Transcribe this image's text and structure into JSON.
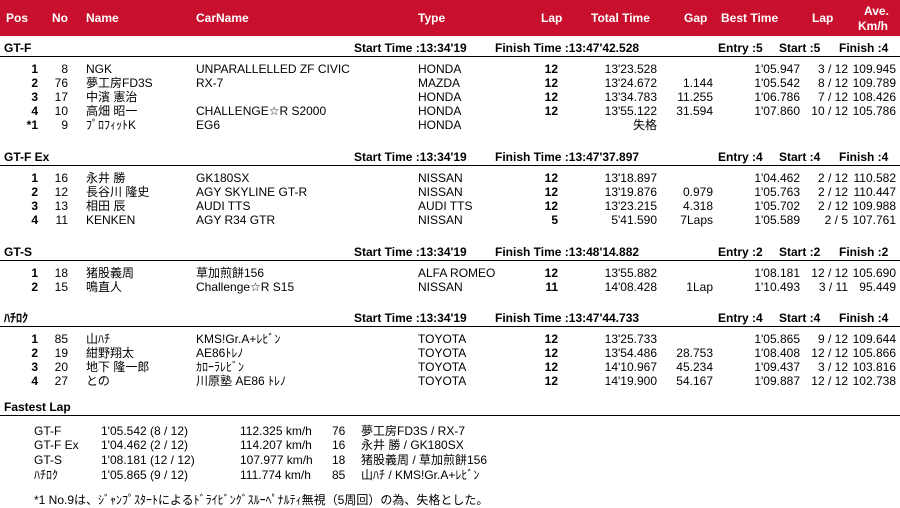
{
  "header": {
    "pos": "Pos",
    "no": "No",
    "name": "Name",
    "carname": "CarName",
    "type": "Type",
    "lap": "Lap",
    "total_time": "Total Time",
    "gap": "Gap",
    "best_time": "Best Time",
    "best_lap": "Lap",
    "ave_line1": "Ave.",
    "ave_line2": "Km/h"
  },
  "classes": [
    {
      "name": "GT-F",
      "start": "Start Time :13:34'19",
      "finish": "Finish Time :13:47'42.528",
      "entry": "Entry :5",
      "started": "Start :5",
      "finished": "Finish :4",
      "rows": [
        {
          "pos": "1",
          "no": "8",
          "name": "NGK",
          "car": "UNPARALLELLED ZF CIVIC",
          "type": "HONDA",
          "lap": "12",
          "total": "13'23.528",
          "gap": "",
          "best": "1'05.947",
          "blap": "3 / 12",
          "ave": "109.945"
        },
        {
          "pos": "2",
          "no": "76",
          "name": "夢工房FD3S",
          "car": "RX-7",
          "type": "MAZDA",
          "lap": "12",
          "total": "13'24.672",
          "gap": "1.144",
          "best": "1'05.542",
          "blap": "8 / 12",
          "ave": "109.789"
        },
        {
          "pos": "3",
          "no": "17",
          "name": "中濱 憲治",
          "car": "",
          "type": "HONDA",
          "lap": "12",
          "total": "13'34.783",
          "gap": "11.255",
          "best": "1'06.786",
          "blap": "7 / 12",
          "ave": "108.426"
        },
        {
          "pos": "4",
          "no": "10",
          "name": "高畑 昭一",
          "car": "CHALLENGE☆R S2000",
          "type": "HONDA",
          "lap": "12",
          "total": "13'55.122",
          "gap": "31.594",
          "best": "1'07.860",
          "blap": "10 / 12",
          "ave": "105.786"
        },
        {
          "pos": "*1",
          "no": "9",
          "name": "ﾌﾟﾛﾌｨｯﾄK",
          "car": "EG6",
          "type": "HONDA",
          "lap": "",
          "total": "失格",
          "gap": "",
          "best": "",
          "blap": "",
          "ave": ""
        }
      ]
    },
    {
      "name": "GT-F Ex",
      "start": "Start Time :13:34'19",
      "finish": "Finish Time :13:47'37.897",
      "entry": "Entry :4",
      "started": "Start :4",
      "finished": "Finish :4",
      "rows": [
        {
          "pos": "1",
          "no": "16",
          "name": "永井 勝",
          "car": "GK180SX",
          "type": "NISSAN",
          "lap": "12",
          "total": "13'18.897",
          "gap": "",
          "best": "1'04.462",
          "blap": "2 / 12",
          "ave": "110.582"
        },
        {
          "pos": "2",
          "no": "12",
          "name": "長谷川 隆史",
          "car": "AGY SKYLINE GT-R",
          "type": "NISSAN",
          "lap": "12",
          "total": "13'19.876",
          "gap": "0.979",
          "best": "1'05.763",
          "blap": "2 / 12",
          "ave": "110.447"
        },
        {
          "pos": "3",
          "no": "13",
          "name": "相田 辰",
          "car": "AUDI TTS",
          "type": "AUDI TTS",
          "lap": "12",
          "total": "13'23.215",
          "gap": "4.318",
          "best": "1'05.702",
          "blap": "2 / 12",
          "ave": "109.988"
        },
        {
          "pos": "4",
          "no": "11",
          "name": "KENKEN",
          "car": "AGY R34 GTR",
          "type": "NISSAN",
          "lap": "5",
          "total": "5'41.590",
          "gap": "7Laps",
          "best": "1'05.589",
          "blap": "2 / 5",
          "ave": "107.761"
        }
      ]
    },
    {
      "name": "GT-S",
      "start": "Start Time :13:34'19",
      "finish": "Finish Time :13:48'14.882",
      "entry": "Entry :2",
      "started": "Start :2",
      "finished": "Finish :2",
      "rows": [
        {
          "pos": "1",
          "no": "18",
          "name": "猪股義周",
          "car": "草加煎餅156",
          "type": "ALFA ROMEO",
          "lap": "12",
          "total": "13'55.882",
          "gap": "",
          "best": "1'08.181",
          "blap": "12 / 12",
          "ave": "105.690"
        },
        {
          "pos": "2",
          "no": "15",
          "name": "鳴直人",
          "car": "Challenge☆R S15",
          "type": "NISSAN",
          "lap": "11",
          "total": "14'08.428",
          "gap": "1Lap",
          "best": "1'10.493",
          "blap": "3 / 11",
          "ave": "95.449"
        }
      ]
    },
    {
      "name": "ﾊﾁﾛｸ",
      "start": "Start Time :13:34'19",
      "finish": "Finish Time :13:47'44.733",
      "entry": "Entry :4",
      "started": "Start :4",
      "finished": "Finish :4",
      "rows": [
        {
          "pos": "1",
          "no": "85",
          "name": "山ﾊﾁ",
          "car": "KMS!Gr.A+ﾚﾋﾞﾝ",
          "type": "TOYOTA",
          "lap": "12",
          "total": "13'25.733",
          "gap": "",
          "best": "1'05.865",
          "blap": "9 / 12",
          "ave": "109.644"
        },
        {
          "pos": "2",
          "no": "19",
          "name": "紺野翔太",
          "car": "AE86ﾄﾚﾉ",
          "type": "TOYOTA",
          "lap": "12",
          "total": "13'54.486",
          "gap": "28.753",
          "best": "1'08.408",
          "blap": "12 / 12",
          "ave": "105.866"
        },
        {
          "pos": "3",
          "no": "20",
          "name": "地下 隆一郎",
          "car": "ｶﾛｰﾗﾚﾋﾞﾝ",
          "type": "TOYOTA",
          "lap": "12",
          "total": "14'10.967",
          "gap": "45.234",
          "best": "1'09.437",
          "blap": "3 / 12",
          "ave": "103.816"
        },
        {
          "pos": "4",
          "no": "27",
          "name": "との",
          "car": "川原塾 AE86 ﾄﾚﾉ",
          "type": "TOYOTA",
          "lap": "12",
          "total": "14'19.900",
          "gap": "54.167",
          "best": "1'09.887",
          "blap": "12 / 12",
          "ave": "102.738"
        }
      ]
    }
  ],
  "fastest_lap": {
    "title": "Fastest Lap",
    "rows": [
      {
        "cls": "GT-F",
        "time": "1'05.542 (8 / 12)",
        "speed": "112.325 km/h",
        "no": "76",
        "who": "夢工房FD3S / RX-7"
      },
      {
        "cls": "GT-F Ex",
        "time": "1'04.462 (2 / 12)",
        "speed": "114.207 km/h",
        "no": "16",
        "who": "永井 勝 / GK180SX"
      },
      {
        "cls": "GT-S",
        "time": "1'08.181 (12 / 12)",
        "speed": "107.977 km/h",
        "no": "18",
        "who": "猪股義周 / 草加煎餅156"
      },
      {
        "cls": "ﾊﾁﾛｸ",
        "time": "1'05.865 (9 / 12)",
        "speed": "111.774 km/h",
        "no": "85",
        "who": "山ﾊﾁ / KMS!Gr.A+ﾚﾋﾞﾝ"
      }
    ]
  },
  "note": "*1 No.9は、ｼﾞｬﾝﾌﾟｽﾀｰﾄによるﾄﾞﾗｲﾋﾞﾝｸﾞｽﾙｰﾍﾟﾅﾙﾃｨ無視（5周回）の為、失格とした。",
  "colors": {
    "header_bg": "#c8102e",
    "header_text": "#ffffff"
  }
}
